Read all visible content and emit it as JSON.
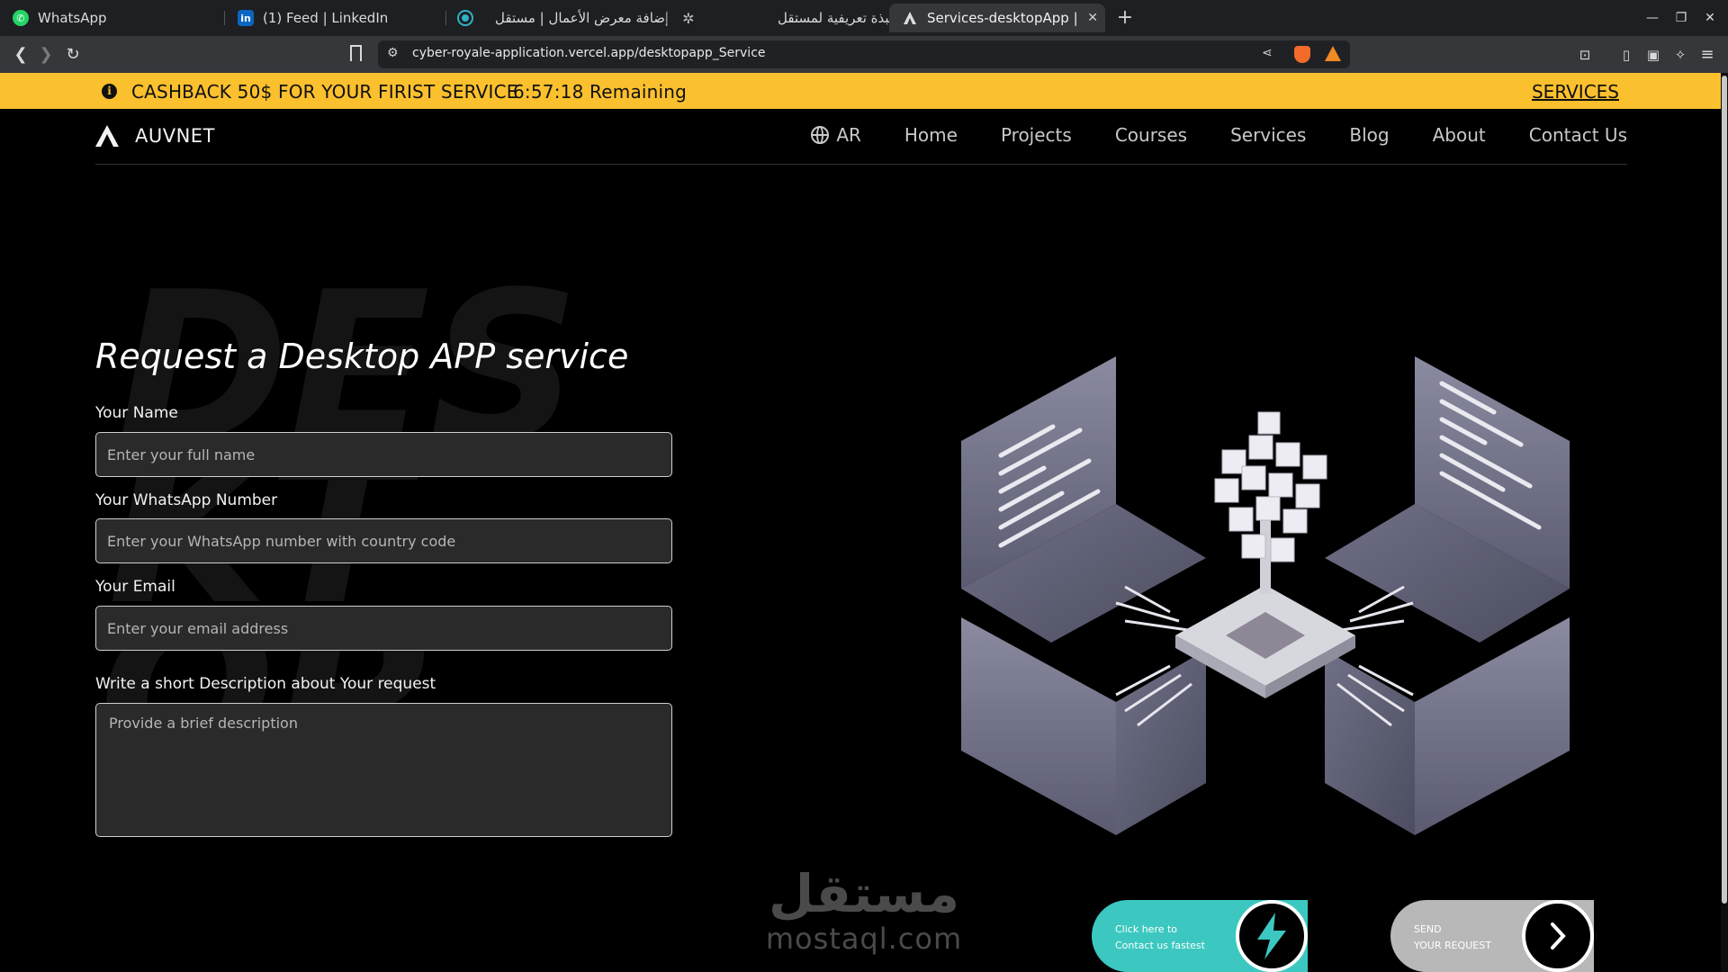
{
  "browser": {
    "tabs": [
      {
        "title": "WhatsApp",
        "icon": "whatsapp-icon",
        "color": "#25d366"
      },
      {
        "title": "(1) Feed | LinkedIn",
        "icon": "linkedin-icon",
        "color": "#0a66c2"
      },
      {
        "title": "إضافة معرض الأعمال | مستقل",
        "icon": "mostaql-icon",
        "color": "#2fb3c6"
      },
      {
        "title": "نبذة تعريفية لمستقل",
        "icon": "openai-icon",
        "color": "#bbbbbb"
      },
      {
        "title": "Services-desktopApp | AU",
        "icon": "auvnet-icon",
        "color": "#dddddd"
      }
    ],
    "url": "cyber-royale-application.vercel.app/desktopapp_Service"
  },
  "promo": {
    "message": "CASHBACK 50$ FOR YOUR FIRIST SERVICE",
    "countdown": "6:57:18 Remaining",
    "link": "SERVICES",
    "color": "#fbc02d"
  },
  "nav": {
    "brand": "AUVNET",
    "lang": "AR",
    "links": [
      "Home",
      "Projects",
      "Courses",
      "Services",
      "Blog",
      "About",
      "Contact Us"
    ]
  },
  "form": {
    "title": "Request a Desktop APP service",
    "name_label": "Your Name",
    "name_placeholder": "Enter your full name",
    "whatsapp_label": "Your WhatsApp Number",
    "whatsapp_placeholder": "Enter your WhatsApp number with country code",
    "email_label": "Your Email",
    "email_placeholder": "Enter your email address",
    "desc_label": "Write a short Description about Your request",
    "desc_placeholder": "Provide a brief description"
  },
  "background_word": "DESKTOP",
  "watermark": {
    "arabic": "مستقل",
    "latin": "mostaql.com"
  },
  "cta": {
    "contact_line1": "Click here to",
    "contact_line2": "Contact us fastest",
    "send_line1": "SEND",
    "send_line2": "YOUR REQUEST",
    "contact_color": "#3cc8c0",
    "send_color": "#b8b8b8"
  }
}
